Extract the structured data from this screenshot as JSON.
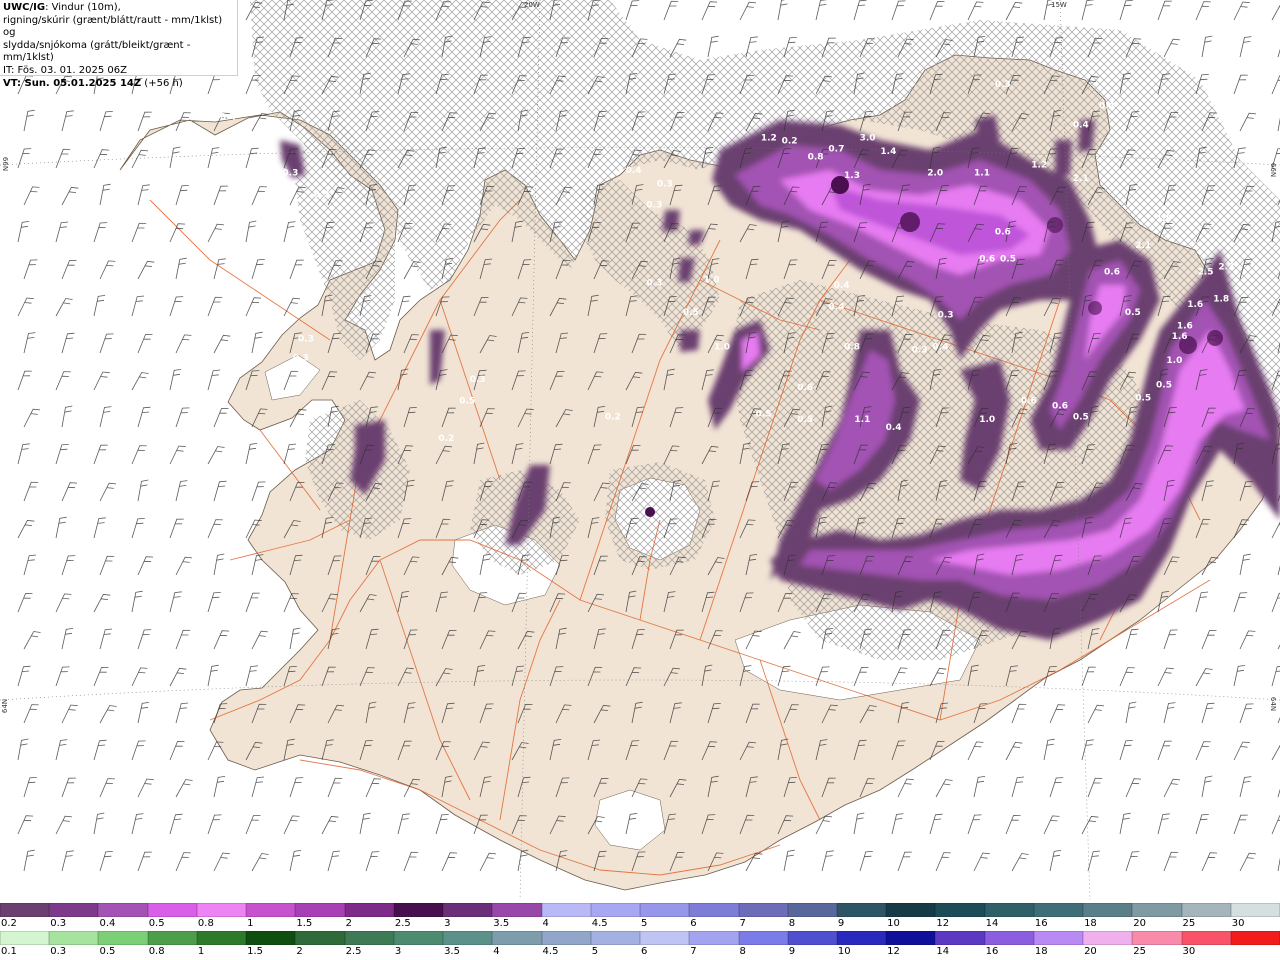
{
  "info": {
    "model": "UWC/IG",
    "desc_line1": ": Vindur (10m),",
    "desc_line2": "rigning/skúrir (grænt/blátt/rautt - mm/1klst) og",
    "desc_line3": "slydda/snjókoma (grátt/bleikt/grænt - mm/1klst)",
    "it": "IT: Fös. 03. 01. 2025 06Z",
    "vt": "VT: Sun. 05.01.2025 14Z",
    "vt_lead": " (+56 h)"
  },
  "coords": {
    "lon_20w": "20W",
    "lon_15w": "15W",
    "lat_66n_left": "66N",
    "lat_66n_right": "66N",
    "lat_64n_left": "64N",
    "lat_64n_right": "64N"
  },
  "colors": {
    "land": "#f2e4d5",
    "road": "#e2622a",
    "hatch": "#9a9a9a",
    "precip_light": "#bf55d9",
    "precip_mid": "#e77cf2",
    "precip_dark": "#7a3f80",
    "precip_darkest": "#4a0f4f"
  },
  "map_values": [
    {
      "label": "3.0",
      "lon": -16.85,
      "lat": 66.1
    },
    {
      "label": "1.4",
      "lon": -16.65,
      "lat": 66.05
    },
    {
      "label": "2.0",
      "lon": -16.2,
      "lat": 65.97
    },
    {
      "label": "1.1",
      "lon": -15.75,
      "lat": 65.97
    },
    {
      "label": "1.2",
      "lon": -15.2,
      "lat": 66.0
    },
    {
      "label": "2.1",
      "lon": -14.8,
      "lat": 65.95
    },
    {
      "label": "1.3",
      "lon": -17.0,
      "lat": 65.96
    },
    {
      "label": "0.8",
      "lon": -17.35,
      "lat": 66.03
    },
    {
      "label": "0.2",
      "lon": -17.6,
      "lat": 66.09
    },
    {
      "label": "1.2",
      "lon": -17.8,
      "lat": 66.1
    },
    {
      "label": "0.7",
      "lon": -17.15,
      "lat": 66.06
    },
    {
      "label": "0.6",
      "lon": -15.55,
      "lat": 65.75
    },
    {
      "label": "0.6",
      "lon": -15.7,
      "lat": 65.65
    },
    {
      "label": "0.5",
      "lon": -15.5,
      "lat": 65.65
    },
    {
      "label": "1.5",
      "lon": -14.0,
      "lat": 65.8
    },
    {
      "label": "2.1",
      "lon": -14.2,
      "lat": 65.7
    },
    {
      "label": "0.6",
      "lon": -14.5,
      "lat": 65.6
    },
    {
      "label": "2.5",
      "lon": -13.6,
      "lat": 65.6
    },
    {
      "label": "2.3",
      "lon": -13.4,
      "lat": 65.62
    },
    {
      "label": "1.6",
      "lon": -13.7,
      "lat": 65.48
    },
    {
      "label": "1.8",
      "lon": -13.45,
      "lat": 65.5
    },
    {
      "label": "1.6",
      "lon": -13.8,
      "lat": 65.4
    },
    {
      "label": "1.6",
      "lon": -13.85,
      "lat": 65.36
    },
    {
      "label": "1.0",
      "lon": -13.9,
      "lat": 65.27
    },
    {
      "label": "0.5",
      "lon": -14.3,
      "lat": 65.45
    },
    {
      "label": "0.5",
      "lon": -14.0,
      "lat": 65.18
    },
    {
      "label": "0.5",
      "lon": -14.2,
      "lat": 65.13
    },
    {
      "label": "0.4",
      "lon": -17.1,
      "lat": 65.55
    },
    {
      "label": "0.4",
      "lon": -17.15,
      "lat": 65.47
    },
    {
      "label": "0.8",
      "lon": -17.0,
      "lat": 65.32
    },
    {
      "label": "0.6",
      "lon": -17.45,
      "lat": 65.17
    },
    {
      "label": "0.3",
      "lon": -16.1,
      "lat": 65.44
    },
    {
      "label": "0.3",
      "lon": -16.35,
      "lat": 65.31
    },
    {
      "label": "0.4",
      "lon": -16.15,
      "lat": 65.32
    },
    {
      "label": "0.6",
      "lon": -15.3,
      "lat": 65.12
    },
    {
      "label": "0.5",
      "lon": -17.85,
      "lat": 65.07
    },
    {
      "label": "0.5",
      "lon": -17.45,
      "lat": 65.05
    },
    {
      "label": "0.4",
      "lon": -16.6,
      "lat": 65.02
    },
    {
      "label": "1.0",
      "lon": -15.7,
      "lat": 65.05
    },
    {
      "label": "1.1",
      "lon": -16.9,
      "lat": 65.05
    },
    {
      "label": "0.5",
      "lon": -14.8,
      "lat": 65.06
    },
    {
      "label": "0.6",
      "lon": -15.0,
      "lat": 65.1
    },
    {
      "label": "1.0",
      "lon": -18.35,
      "lat": 65.57
    },
    {
      "label": "0.5",
      "lon": -18.55,
      "lat": 65.45
    },
    {
      "label": "0.3",
      "lon": -18.9,
      "lat": 65.56
    },
    {
      "label": "0.3",
      "lon": -23.1,
      "lat": 66.22
    },
    {
      "label": "0.4",
      "lon": -23.0,
      "lat": 66.18
    },
    {
      "label": "0.3",
      "lon": -22.4,
      "lat": 65.97
    },
    {
      "label": "0.3",
      "lon": -22.1,
      "lat": 65.89
    },
    {
      "label": "0.3",
      "lon": -22.25,
      "lat": 65.35
    },
    {
      "label": "0.3",
      "lon": -22.3,
      "lat": 65.28
    },
    {
      "label": "0.3",
      "lon": -20.6,
      "lat": 65.2
    },
    {
      "label": "0.5",
      "lon": -20.7,
      "lat": 65.12
    },
    {
      "label": "0.2",
      "lon": -19.3,
      "lat": 65.06
    },
    {
      "label": "0.2",
      "lon": -20.9,
      "lat": 64.98
    },
    {
      "label": "0.4",
      "lon": -19.1,
      "lat": 65.98
    },
    {
      "label": "0.3",
      "lon": -18.8,
      "lat": 65.93
    },
    {
      "label": "0.3",
      "lon": -18.9,
      "lat": 65.85
    },
    {
      "label": "0.3",
      "lon": -15.55,
      "lat": 66.3
    },
    {
      "label": "0.4",
      "lon": -14.8,
      "lat": 66.15
    },
    {
      "label": "0.4",
      "lon": -14.55,
      "lat": 66.22
    },
    {
      "label": "1.0",
      "lon": -18.25,
      "lat": 65.32
    }
  ],
  "legend": {
    "snow_labels": [
      "0.2",
      "0.3",
      "0.4",
      "0.5",
      "0.8",
      "1",
      "1.5",
      "2",
      "2.5",
      "3",
      "3.5",
      "4",
      "4.5",
      "5",
      "6",
      "7",
      "8",
      "9",
      "10",
      "12",
      "14",
      "16",
      "18",
      "20",
      "25",
      "30"
    ],
    "rain_labels": [
      "0.1",
      "0.3",
      "0.5",
      "0.8",
      "1",
      "1.5",
      "2",
      "2.5",
      "3",
      "3.5",
      "4",
      "4.5",
      "5",
      "6",
      "7",
      "8",
      "9",
      "10",
      "12",
      "14",
      "16",
      "18",
      "20",
      "25",
      "30"
    ],
    "snow_colors": [
      "#6b3f70",
      "#7d3a8a",
      "#a353b3",
      "#d95ee8",
      "#ee83f3",
      "#c752cf",
      "#a83fb4",
      "#7d2a88",
      "#480f4e",
      "#6a2f78",
      "#9848a8",
      "#b9b9f7",
      "#a8a8f2",
      "#9696ea",
      "#7d7dd8",
      "#6c6cb8",
      "#58689a",
      "#2d5565",
      "#153b47",
      "#1d4b57",
      "#2f6068",
      "#3f6e78",
      "#5a7f89",
      "#7f9aa3",
      "#a4b6bc",
      "#d5dfe0"
    ],
    "rain_colors": [
      "#d3f5cf",
      "#a6e39e",
      "#7ccf76",
      "#4e9d4a",
      "#2e7a2b",
      "#0e4f10",
      "#2f6a3a",
      "#3e7a56",
      "#4d8b70",
      "#5c918a",
      "#7d9dac",
      "#91a6c9",
      "#a4b0e2",
      "#bfc4f4",
      "#a3a3ef",
      "#7c7ce8",
      "#4f4fcf",
      "#2929bd",
      "#0f0f9a",
      "#5b39c2",
      "#8b5edf",
      "#b98af4",
      "#f0b0ee",
      "#f88aaa",
      "#f9536a",
      "#f21c1c"
    ]
  }
}
